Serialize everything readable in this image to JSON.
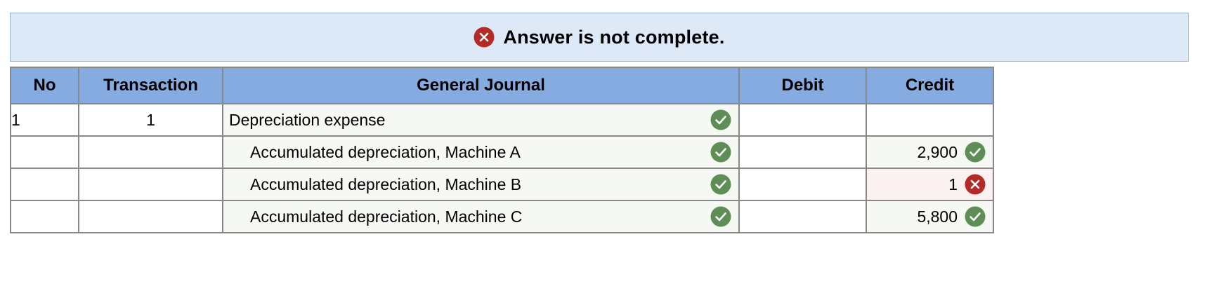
{
  "banner": {
    "text": "Answer is not complete.",
    "icon": "x-circle-icon",
    "icon_color": "#b52a26",
    "background": "#dde9f7"
  },
  "table": {
    "headers": [
      "No",
      "Transaction",
      "General Journal",
      "Debit",
      "Credit"
    ],
    "header_background": "#86abe0",
    "rows": [
      {
        "no": "1",
        "transaction": "1",
        "account": "Depreciation expense",
        "indent": false,
        "account_status": "correct",
        "debit": "",
        "credit": "",
        "credit_status": ""
      },
      {
        "no": "",
        "transaction": "",
        "account": "Accumulated depreciation, Machine A",
        "indent": true,
        "account_status": "correct",
        "debit": "",
        "credit": "2,900",
        "credit_status": "correct"
      },
      {
        "no": "",
        "transaction": "",
        "account": "Accumulated depreciation, Machine B",
        "indent": true,
        "account_status": "correct",
        "debit": "",
        "credit": "1",
        "credit_status": "incorrect"
      },
      {
        "no": "",
        "transaction": "",
        "account": "Accumulated depreciation, Machine C",
        "indent": true,
        "account_status": "correct",
        "debit": "",
        "credit": "5,800",
        "credit_status": "correct"
      }
    ]
  },
  "colors": {
    "correct": "#5e8d55",
    "incorrect": "#b52a26"
  }
}
